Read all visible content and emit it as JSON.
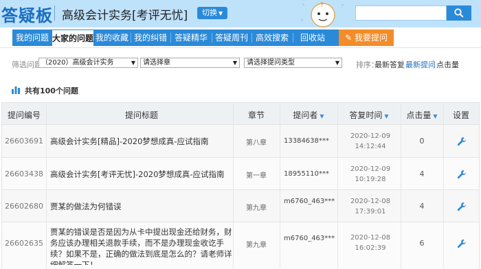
{
  "header": {
    "logo": "答疑板",
    "subject": "高级会计实务[考评无忧]",
    "switch_label": "切换",
    "search_placeholder": "",
    "search_icon": "search-icon"
  },
  "colors": {
    "header_bg": "#bfe2fb",
    "nav_bg": "#2b8ad8",
    "ask_button": "#f38c2a",
    "link_active": "#1a6fc2"
  },
  "nav": {
    "items": [
      "我的问题",
      "大家的问题",
      "我的收藏夹",
      "我的纠错",
      "答疑精华",
      "答疑周刊",
      "高效搜索",
      "回收站"
    ],
    "active_index": 1,
    "ask_label": "我要提问",
    "ask_icon": "pencil-icon"
  },
  "filter": {
    "label": "筛选问题",
    "course_select": "（2020）高级会计实务",
    "chapter_select": "请选择章",
    "type_select": "请选择提问类型",
    "sort_label": "排序：",
    "sort_options": [
      "最新答复",
      "最新提问",
      "点击量"
    ],
    "sort_active_index": 1
  },
  "summary": {
    "count_text": "共有100个问题",
    "icon": "bar-chart-icon"
  },
  "table": {
    "headers": {
      "id": "提问编号",
      "title": "提问标题",
      "chapter": "章节",
      "asker": "提问者",
      "time": "答复时间",
      "clicks": "点击量",
      "settings": "设置"
    },
    "rows": [
      {
        "id": "26603691",
        "title": "高级会计实务[精品]-2020梦想成真-应试指南",
        "chapter": "第八章",
        "asker": "13384638***",
        "date": "2020-12-09",
        "time": "14:12:44",
        "clicks": "0",
        "settings_icon": "wrench-icon"
      },
      {
        "id": "26603438",
        "title": "高级会计实务[考评无忧]-2020梦想成真-应试指南",
        "chapter": "第一章",
        "asker": "18955110***",
        "date": "2020-12-09",
        "time": "10:19:28",
        "clicks": "4",
        "settings_icon": "wrench-icon"
      },
      {
        "id": "26602680",
        "title": "贾某的做法为何错误",
        "chapter": "第九章",
        "asker": "m6760_463***",
        "date": "2020-12-08",
        "time": "17:39:01",
        "clicks": "4",
        "settings_icon": "wrench-icon"
      },
      {
        "id": "26602635",
        "title": "贾某的错误是否是因为从卡中提出现金还给财务，财务应该办理相关退款手续，而不是办理现金收讫手续？如果不是，正确的做法到底是怎么的？请老师详细解答一下！",
        "chapter": "第九章",
        "asker": "m6760_463***",
        "date": "2020-12-08",
        "time": "16:02:39",
        "clicks": "6",
        "settings_icon": "wrench-icon"
      }
    ]
  }
}
